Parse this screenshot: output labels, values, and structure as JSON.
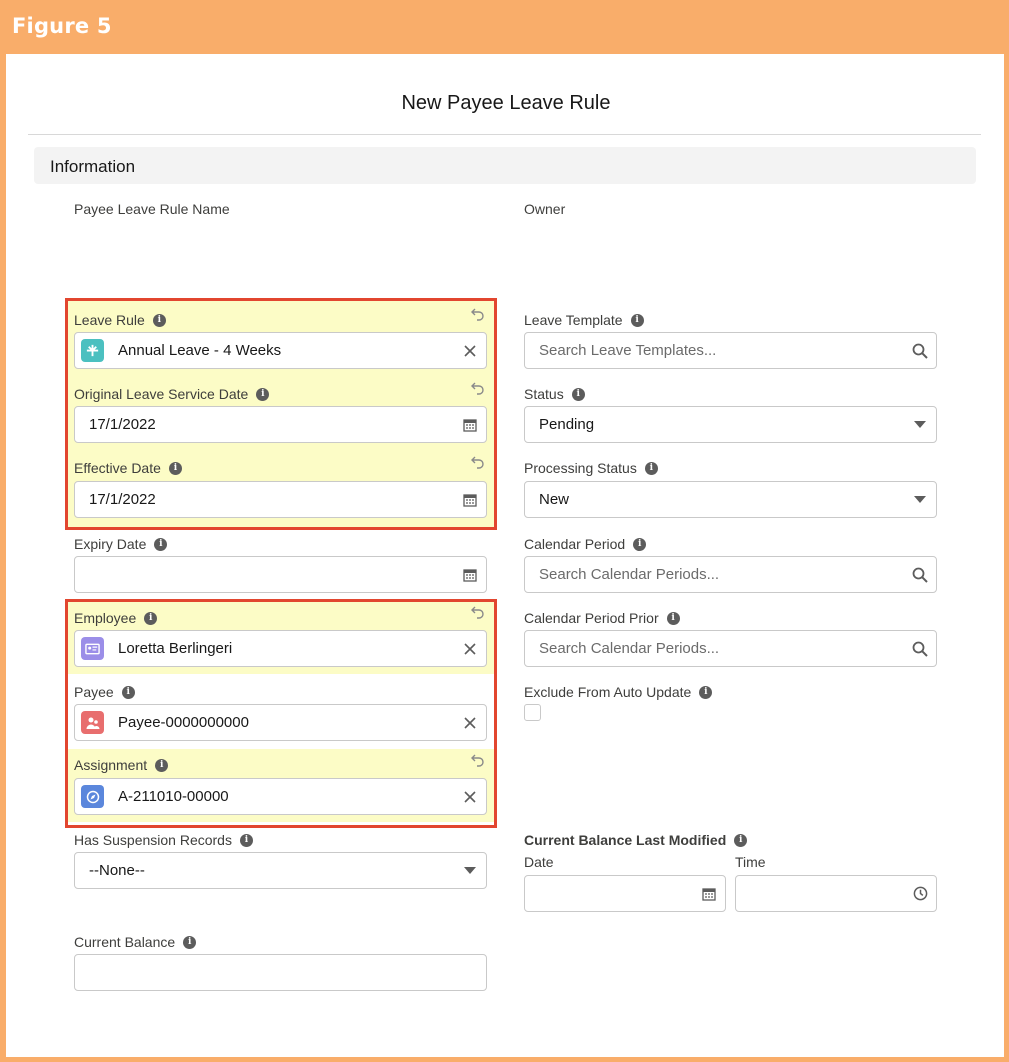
{
  "figure_label": "Figure 5",
  "modal": {
    "title": "New Payee Leave Rule"
  },
  "section": {
    "title": "Information"
  },
  "fields": {
    "payee_leave_rule_name": {
      "label": "Payee Leave Rule Name"
    },
    "owner": {
      "label": "Owner"
    },
    "leave_rule": {
      "label": "Leave Rule",
      "value": "Annual Leave - 4 Weeks"
    },
    "original_leave_service_date": {
      "label": "Original Leave Service Date",
      "value": "17/1/2022"
    },
    "effective_date": {
      "label": "Effective Date",
      "value": "17/1/2022"
    },
    "expiry_date": {
      "label": "Expiry Date",
      "value": ""
    },
    "employee": {
      "label": "Employee",
      "value": "Loretta Berlingeri"
    },
    "payee": {
      "label": "Payee",
      "value": "Payee-0000000000"
    },
    "assignment": {
      "label": "Assignment",
      "value": "A-211010-00000"
    },
    "has_suspension_records": {
      "label": "Has Suspension Records",
      "value": "--None--"
    },
    "current_balance": {
      "label": "Current Balance",
      "value": ""
    },
    "leave_template": {
      "label": "Leave Template",
      "placeholder": "Search Leave Templates..."
    },
    "status": {
      "label": "Status",
      "value": "Pending"
    },
    "processing_status": {
      "label": "Processing Status",
      "value": "New"
    },
    "calendar_period": {
      "label": "Calendar Period",
      "placeholder": "Search Calendar Periods..."
    },
    "calendar_period_prior": {
      "label": "Calendar Period Prior",
      "placeholder": "Search Calendar Periods..."
    },
    "exclude_from_auto_update": {
      "label": "Exclude From Auto Update",
      "checked": false
    },
    "current_balance_last_modified": {
      "label": "Current Balance Last Modified",
      "date_label": "Date",
      "time_label": "Time",
      "date_value": "",
      "time_value": ""
    }
  },
  "icons": {
    "leave_rule": "leave-rule-icon",
    "employee": "employee-icon",
    "payee": "payee-icon",
    "assignment": "assignment-icon",
    "clear": "close-icon",
    "calendar": "calendar-icon",
    "search": "search-icon",
    "dropdown": "chevron-down-icon",
    "clock": "clock-icon",
    "undo": "undo-icon",
    "info": "info-icon"
  },
  "colors": {
    "highlight": "#fcfcc6",
    "callout_border": "#e2462f",
    "frame": "#f9ad6a",
    "leave_rule_icon_bg": "#4bc0c0",
    "employee_icon_bg": "#9b8ee8",
    "payee_icon_bg": "#e86e6e",
    "assignment_icon_bg": "#5b87dc"
  }
}
